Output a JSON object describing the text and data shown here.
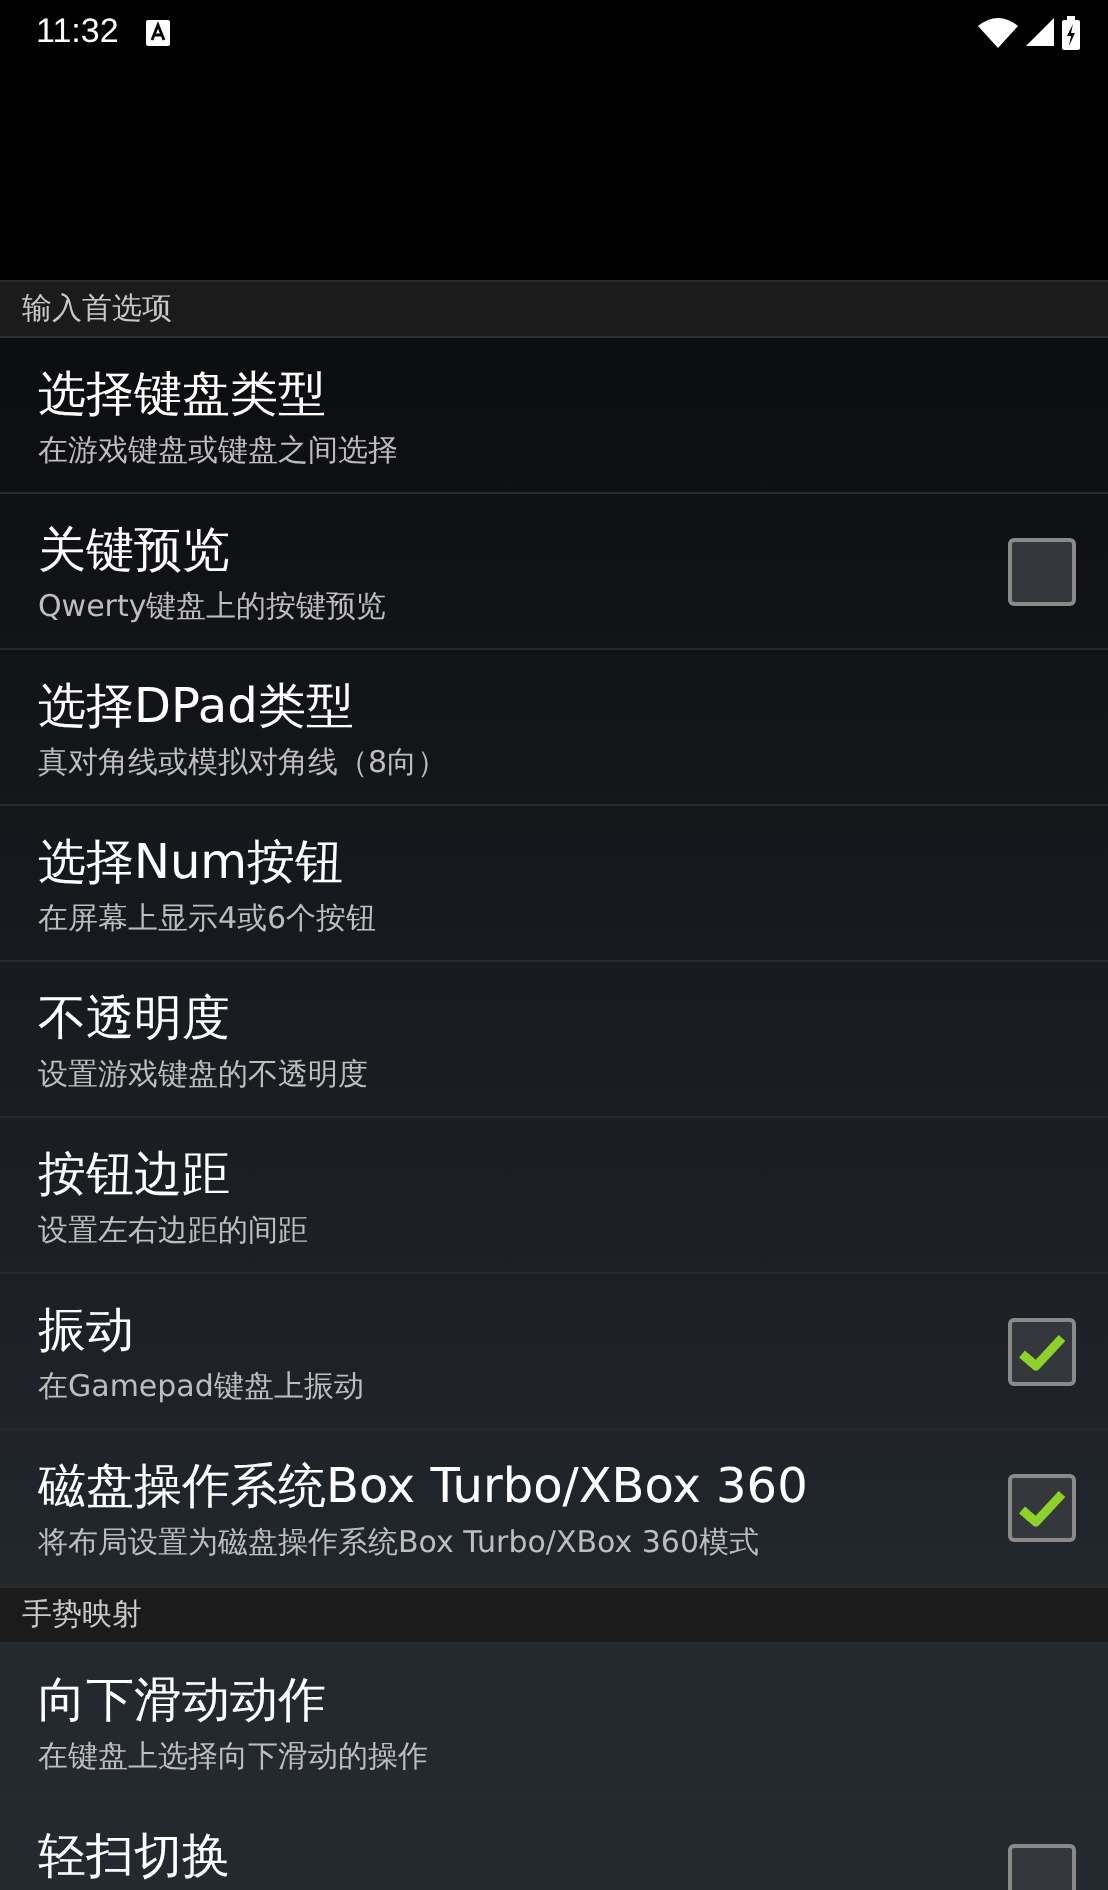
{
  "status_bar": {
    "time": "11:32"
  },
  "sections": [
    {
      "title": "输入首选项",
      "items": [
        {
          "kind": "plain",
          "title": "选择键盘类型",
          "subtitle": "在游戏键盘或键盘之间选择"
        },
        {
          "kind": "checkbox",
          "title": "关键预览",
          "subtitle": "Qwerty键盘上的按键预览",
          "checked": false
        },
        {
          "kind": "plain",
          "title": "选择DPad类型",
          "subtitle": "真对角线或模拟对角线（8向）"
        },
        {
          "kind": "plain",
          "title": "选择Num按钮",
          "subtitle": "在屏幕上显示4或6个按钮"
        },
        {
          "kind": "plain",
          "title": "不透明度",
          "subtitle": "设置游戏键盘的不透明度"
        },
        {
          "kind": "plain",
          "title": "按钮边距",
          "subtitle": "设置左右边距的间距"
        },
        {
          "kind": "checkbox",
          "title": "振动",
          "subtitle": "在Gamepad键盘上振动",
          "checked": true
        },
        {
          "kind": "checkbox",
          "title": "磁盘操作系统Box Turbo/XBox 360",
          "subtitle": "将布局设置为磁盘操作系统Box Turbo/XBox 360模式",
          "checked": true
        }
      ]
    },
    {
      "title": "手势映射",
      "items": [
        {
          "kind": "plain",
          "title": "向下滑动动作",
          "subtitle": "在键盘上选择向下滑动的操作"
        },
        {
          "kind": "checkbox",
          "title": "轻扫切换",
          "checked": false
        }
      ]
    }
  ]
}
